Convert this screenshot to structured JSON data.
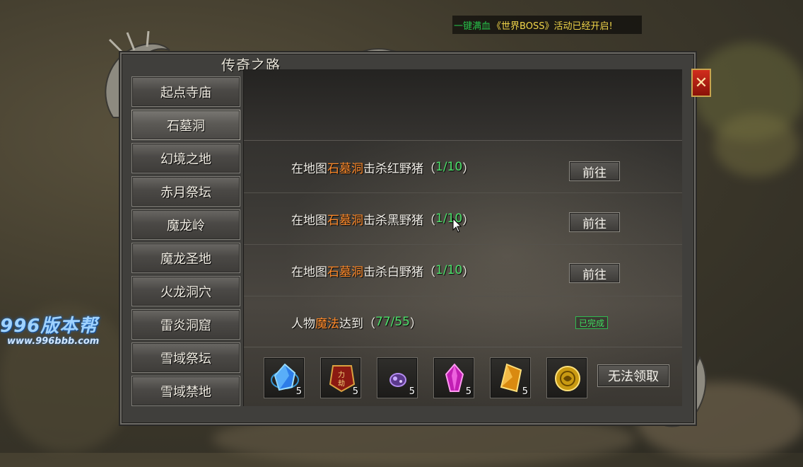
{
  "notice": {
    "prefix": "一键满血",
    "boss": "《世界BOSS》",
    "suffix": "活动已经开启!"
  },
  "watermark": {
    "big": "996版本帮",
    "small": "www.996bbb.com"
  },
  "panel": {
    "title": "传奇之路",
    "close_icon": "close-x"
  },
  "sidebar": {
    "items": [
      {
        "label": "起点寺庙"
      },
      {
        "label": "石墓洞"
      },
      {
        "label": "幻境之地"
      },
      {
        "label": "赤月祭坛"
      },
      {
        "label": "魔龙岭"
      },
      {
        "label": "魔龙圣地"
      },
      {
        "label": "火龙洞穴"
      },
      {
        "label": "雷炎洞窟"
      },
      {
        "label": "雪域祭坛"
      },
      {
        "label": "雪域禁地"
      }
    ],
    "active_index": 1
  },
  "tasks": [
    {
      "pre": "在地图",
      "map": "石墓洞",
      "action": "击杀红野猪",
      "open": "（",
      "progress": "1/10",
      "close": "）",
      "button": "前往"
    },
    {
      "pre": "在地图",
      "map": "石墓洞",
      "action": "击杀黑野猪",
      "open": "（",
      "progress": "1/10",
      "close": "）",
      "button": "前往"
    },
    {
      "pre": "在地图",
      "map": "石墓洞",
      "action": "击杀白野猪",
      "open": "（",
      "progress": "1/10",
      "close": "）",
      "button": "前往"
    },
    {
      "pre": "人物",
      "map": "魔法",
      "action": "达到",
      "open": "（",
      "progress": "77/55",
      "close": "）",
      "status": "已完成"
    }
  ],
  "rewards": {
    "items": [
      {
        "icon": "blue-crystal-icon",
        "count": "5"
      },
      {
        "icon": "scroll-token-icon",
        "count": "5"
      },
      {
        "icon": "purple-ore-icon",
        "count": "5"
      },
      {
        "icon": "magenta-crystal-icon",
        "count": "5"
      },
      {
        "icon": "gold-shard-icon",
        "count": "5"
      },
      {
        "icon": "gold-orb-icon",
        "count": ""
      }
    ],
    "claim_button": "无法领取"
  },
  "colors": {
    "map_highlight": "#ff8a2a",
    "progress_green": "#4ce06a",
    "notice_yellow": "#f2d64a",
    "close_red": "#d22d1d"
  }
}
